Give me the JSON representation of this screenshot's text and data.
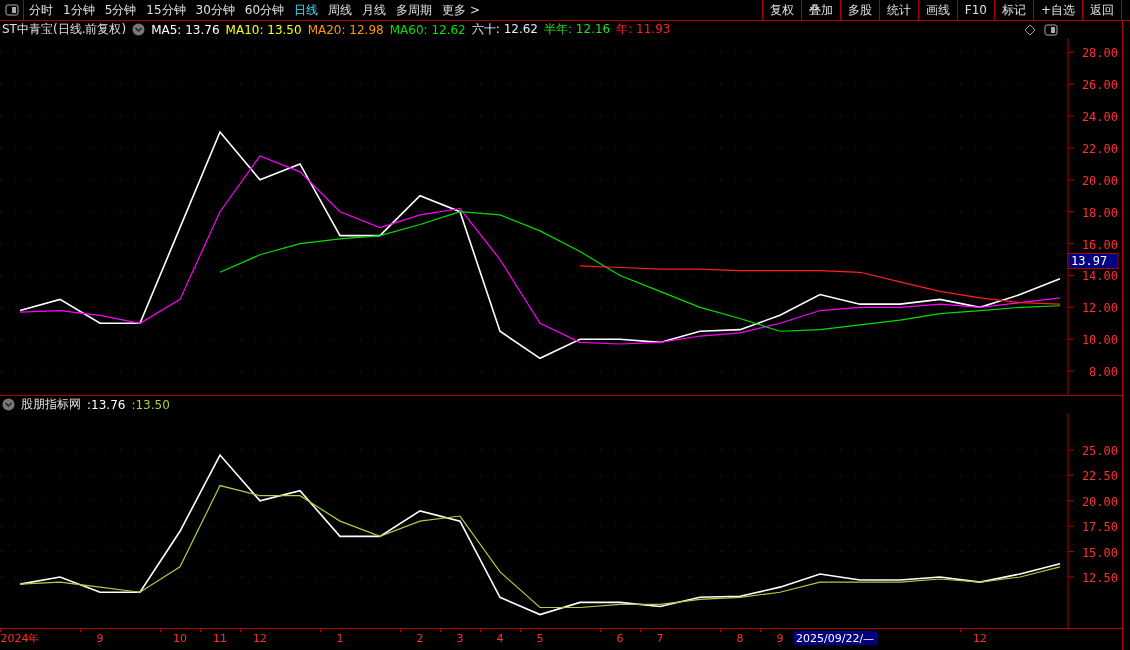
{
  "toolbar": {
    "periods": [
      {
        "label": "分时",
        "selected": false
      },
      {
        "label": "1分钟",
        "selected": false
      },
      {
        "label": "5分钟",
        "selected": false
      },
      {
        "label": "15分钟",
        "selected": false
      },
      {
        "label": "30分钟",
        "selected": false
      },
      {
        "label": "60分钟",
        "selected": false
      },
      {
        "label": "日线",
        "selected": true
      },
      {
        "label": "周线",
        "selected": false
      },
      {
        "label": "月线",
        "selected": false
      },
      {
        "label": "多周期",
        "selected": false
      }
    ],
    "more": {
      "label": "更多",
      "caret": ">"
    },
    "buttons": [
      "复权",
      "叠加",
      "多股",
      "统计",
      "画线",
      "F10",
      "标记",
      "+自选",
      "返回"
    ]
  },
  "main_panel": {
    "title": "ST中青宝(日线.前复权)",
    "legend": [
      {
        "label": "MA5:",
        "value": "13.76",
        "color": "#ffffff"
      },
      {
        "label": "MA10:",
        "value": "13.50",
        "color": "#ffff00"
      },
      {
        "label": "MA20:",
        "value": "12.98",
        "color": "#ff9900"
      },
      {
        "label": "MA60:",
        "value": "12.62",
        "color": "#00e000"
      },
      {
        "label": "六十:",
        "value": "12.62",
        "color": "#d8f0ff"
      },
      {
        "label": "半年:",
        "value": "12.16",
        "color": "#22dd22"
      },
      {
        "label": "年:",
        "value": "11.93",
        "color": "#ff2020"
      }
    ],
    "current_price": "13.97",
    "chart_data": {
      "type": "line",
      "grid": true,
      "ylim": [
        6.5,
        28.9
      ],
      "yticks": [
        {
          "value": 8,
          "label": "8.00"
        },
        {
          "value": 10,
          "label": "10.00"
        },
        {
          "value": 12,
          "label": "12.00"
        },
        {
          "value": 14,
          "label": "14.00"
        },
        {
          "value": 16,
          "label": "16.00"
        },
        {
          "value": 18,
          "label": "18.00"
        },
        {
          "value": 20,
          "label": "20.00"
        },
        {
          "value": 22,
          "label": "22.00"
        },
        {
          "value": 24,
          "label": "24.00"
        },
        {
          "value": 26,
          "label": "26.00"
        },
        {
          "value": 28,
          "label": "28.00"
        }
      ],
      "series": [
        {
          "color": "#ffffff",
          "values": [
            11.8,
            12.5,
            11.0,
            11.0,
            17.0,
            23.0,
            20.0,
            21.0,
            16.5,
            16.5,
            19.0,
            18.0,
            10.5,
            8.8,
            10.0,
            10.0,
            9.8,
            10.5,
            10.6,
            11.5,
            12.8,
            12.2,
            12.2,
            12.5,
            12.0,
            12.8,
            13.8
          ]
        },
        {
          "color": "#ff00ff",
          "values": [
            11.7,
            11.8,
            11.5,
            11.0,
            12.5,
            18.0,
            21.5,
            20.5,
            18.0,
            17.0,
            17.8,
            18.2,
            15.0,
            11.0,
            9.8,
            9.7,
            9.8,
            10.2,
            10.4,
            11.0,
            11.8,
            12.0,
            12.0,
            12.2,
            12.0,
            12.3,
            12.6
          ]
        },
        {
          "color": "#00e000",
          "values": [
            null,
            null,
            null,
            null,
            null,
            14.2,
            15.3,
            16.0,
            16.3,
            16.5,
            17.2,
            18.0,
            17.8,
            16.8,
            15.5,
            14.0,
            13.0,
            12.0,
            11.3,
            10.5,
            10.6,
            10.9,
            11.2,
            11.6,
            11.8,
            12.0,
            12.1
          ]
        },
        {
          "color": "#ff2020",
          "values": [
            null,
            null,
            null,
            null,
            null,
            null,
            null,
            null,
            null,
            null,
            null,
            null,
            null,
            null,
            14.6,
            14.5,
            14.4,
            14.4,
            14.3,
            14.3,
            14.3,
            14.2,
            13.6,
            13.0,
            12.6,
            12.3,
            12.2
          ]
        }
      ]
    }
  },
  "indicator_panel": {
    "title": "股朋指标网",
    "values": [
      {
        "text": ":13.76",
        "color": "#ffffff"
      },
      {
        "text": ":13.50",
        "color": "#a8d040"
      }
    ],
    "chart_data": {
      "type": "line",
      "grid": true,
      "categories": [
        "2024年",
        null,
        "9",
        null,
        "10",
        "11",
        "12",
        null,
        "1",
        null,
        "2",
        "3",
        "4",
        "5",
        null,
        "6",
        "7",
        null,
        "8",
        "9",
        null,
        null,
        null,
        null,
        "12",
        null,
        null
      ],
      "ylim": [
        7.48,
        28.64
      ],
      "annotations": [
        "2025/09/22/—"
      ],
      "yticks": [
        {
          "value": 12.5,
          "label": "12.50"
        },
        {
          "value": 15,
          "label": "15.00"
        },
        {
          "value": 17.5,
          "label": "17.50"
        },
        {
          "value": 20,
          "label": "20.00"
        },
        {
          "value": 22.5,
          "label": "22.50"
        },
        {
          "value": 25,
          "label": "25.00"
        }
      ],
      "series": [
        {
          "color": "#ffffff",
          "values": [
            11.8,
            12.5,
            11.0,
            11.0,
            17.0,
            24.5,
            20.0,
            21.0,
            16.5,
            16.5,
            19.0,
            18.0,
            10.5,
            8.8,
            10.0,
            10.0,
            9.6,
            10.5,
            10.6,
            11.5,
            12.8,
            12.2,
            12.2,
            12.5,
            12.0,
            12.8,
            13.8
          ]
        },
        {
          "color": "#a8d040",
          "values": [
            11.8,
            12.0,
            11.5,
            11.0,
            13.5,
            21.5,
            20.5,
            20.5,
            18.0,
            16.5,
            18.0,
            18.5,
            13.0,
            9.5,
            9.5,
            9.8,
            9.8,
            10.3,
            10.5,
            11.0,
            12.0,
            12.0,
            12.0,
            12.3,
            12.0,
            12.5,
            13.5
          ]
        }
      ]
    }
  }
}
